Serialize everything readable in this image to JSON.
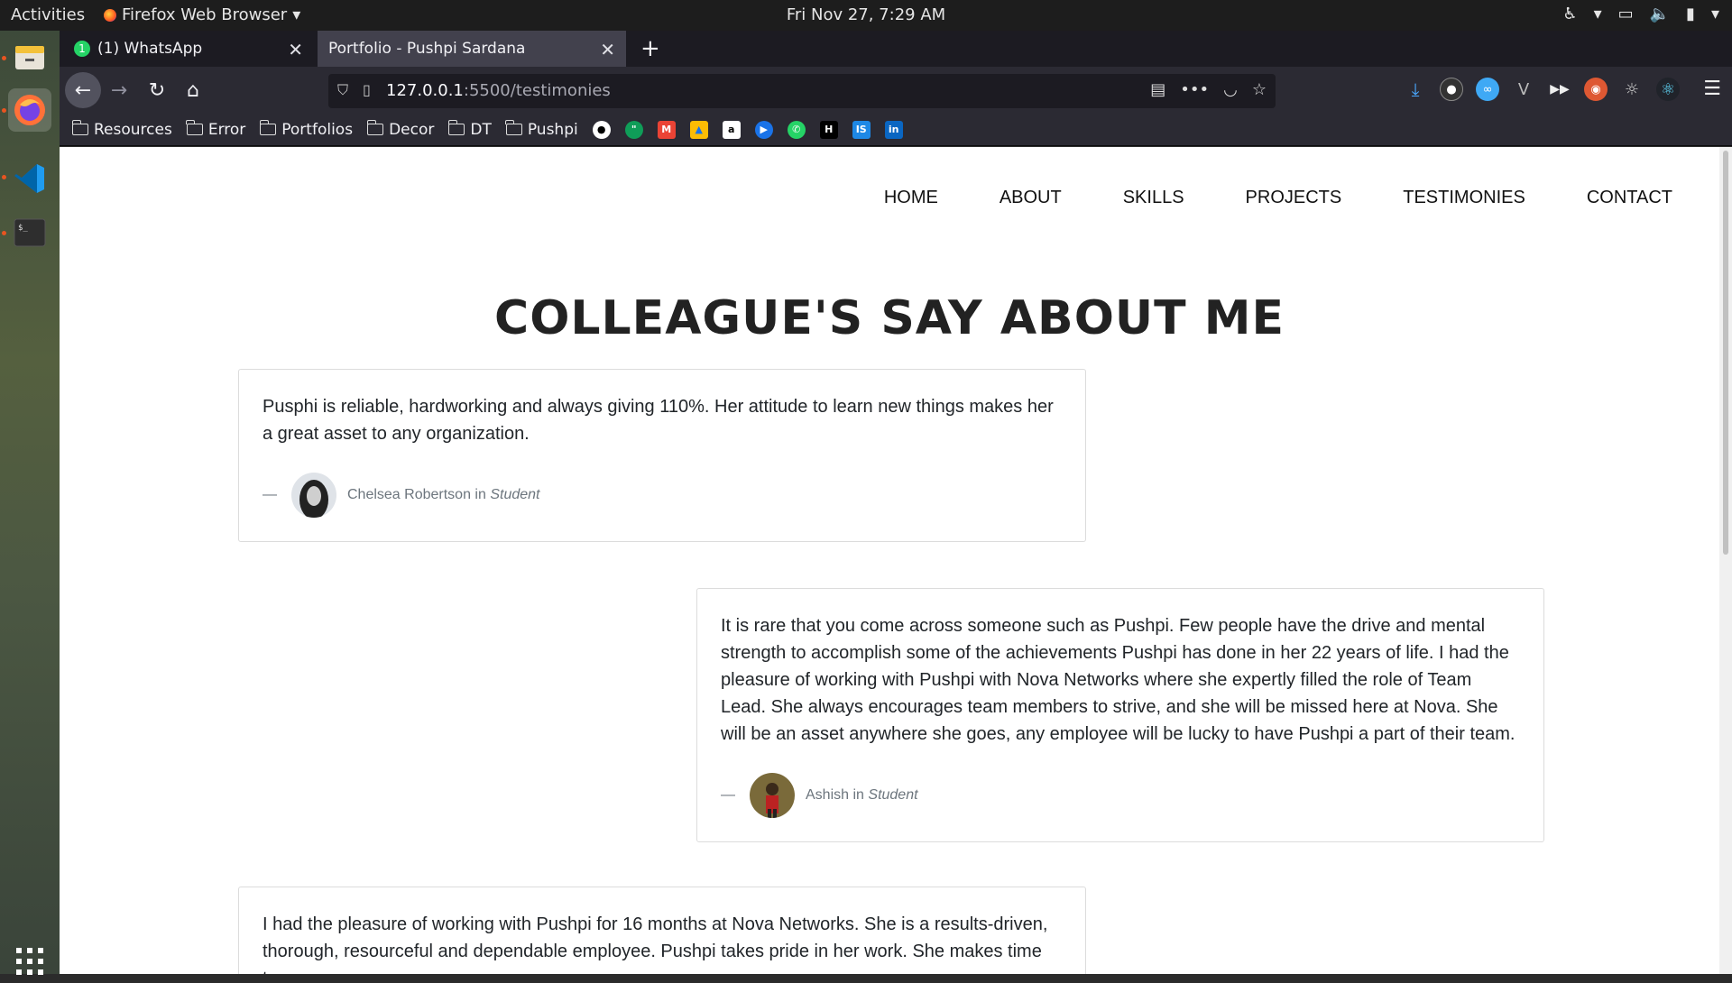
{
  "system": {
    "activities": "Activities",
    "app_name": "Firefox Web Browser",
    "clock": "Fri Nov 27,  7:29 AM"
  },
  "browser": {
    "tabs": [
      {
        "label": "(1) WhatsApp",
        "badge": "1"
      },
      {
        "label": "Portfolio - Pushpi Sardana"
      }
    ],
    "url_host": "127.0.0.1",
    "url_path": ":5500/testimonies",
    "bookmarks": [
      "Resources",
      "Error",
      "Portfolios",
      "Decor",
      "DT",
      "Pushpi"
    ]
  },
  "site": {
    "nav": [
      "HOME",
      "ABOUT",
      "SKILLS",
      "PROJECTS",
      "TESTIMONIES",
      "CONTACT"
    ],
    "heading": "COLLEAGUE'S SAY ABOUT ME",
    "testimonials": [
      {
        "quote": "Pusphi is reliable, hardworking and always giving 110%. Her attitude to learn new things makes her a great asset to any organization.",
        "dash": "—",
        "name": "Chelsea Robertson",
        "in": "in",
        "role": "Student"
      },
      {
        "quote": "It is rare that you come across someone such as Pushpi. Few people have the drive and mental strength to accomplish some of the achievements Pushpi has done in her 22 years of life. I had the pleasure of working with Pushpi with Nova Networks where she expertly filled the role of Team Lead. She always encourages team members to strive, and she will be missed here at Nova. She will be an asset anywhere she goes, any employee will be lucky to have Pushpi a part of their team.",
        "dash": "—",
        "name": "Ashish",
        "in": "in",
        "role": "Student"
      },
      {
        "quote": "I had the pleasure of working with Pushpi for 16 months at Nova Networks. She is a results-driven, thorough, resourceful and dependable employee. Pushpi takes pride in her work. She makes time to"
      }
    ]
  }
}
